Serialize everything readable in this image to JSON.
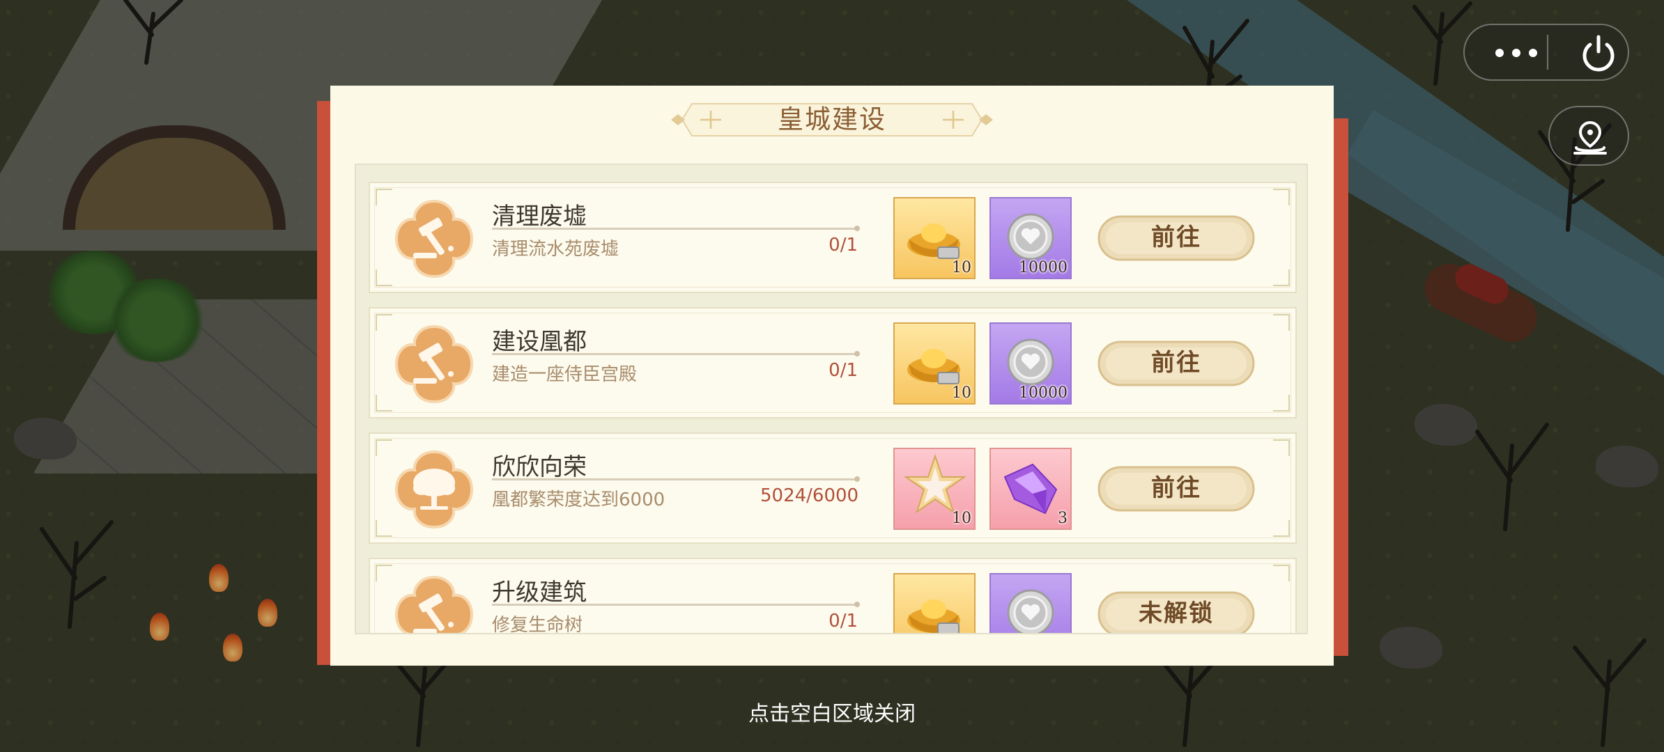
{
  "dialog": {
    "title": "皇城建设",
    "tasks": [
      {
        "name": "清理废墟",
        "desc": "清理流水苑废墟",
        "progress": "0/1",
        "icon": "hammer-icon",
        "rewards": [
          {
            "type": "gold-ingot",
            "count": "10"
          },
          {
            "type": "silver-coin",
            "count": "10000"
          }
        ],
        "button": "前往"
      },
      {
        "name": "建设凰都",
        "desc": "建造一座侍臣宫殿",
        "progress": "0/1",
        "icon": "hammer-icon",
        "rewards": [
          {
            "type": "gold-ingot",
            "count": "10"
          },
          {
            "type": "silver-coin",
            "count": "10000"
          }
        ],
        "button": "前往"
      },
      {
        "name": "欣欣向荣",
        "desc": "凰都繁荣度达到6000",
        "progress": "5024/6000",
        "icon": "tree-icon",
        "rewards": [
          {
            "type": "star-flower",
            "count": "10"
          },
          {
            "type": "purple-crystal",
            "count": "3"
          }
        ],
        "button": "前往"
      },
      {
        "name": "升级建筑",
        "desc": "修复生命树",
        "progress": "0/1",
        "icon": "hammer-icon",
        "rewards": [
          {
            "type": "gold-ingot",
            "count": ""
          },
          {
            "type": "silver-coin",
            "count": ""
          }
        ],
        "button": "未解锁"
      }
    ]
  },
  "close_hint": "点击空白区域关闭",
  "colors": {
    "panel": "#fcf9e7",
    "ribbon": "#c9503a",
    "title": "#8a5e33",
    "progress": "#b0503a",
    "button_text": "#6f4a27"
  }
}
